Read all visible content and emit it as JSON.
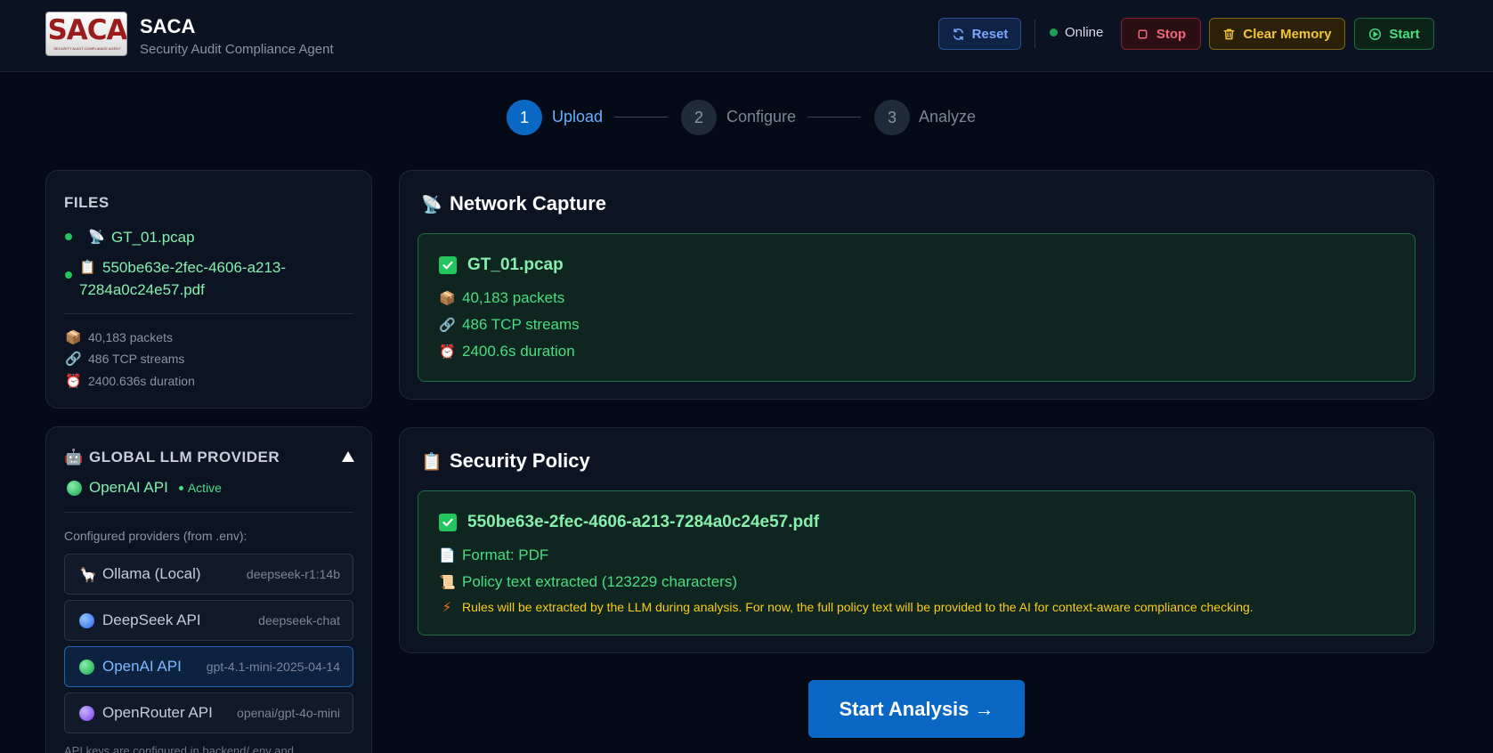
{
  "header": {
    "logo_text": "SACA",
    "logo_subtext": "SECURITY AUDIT COMPLIANCE AGENT",
    "title": "SACA",
    "subtitle": "Security Audit Compliance Agent",
    "buttons": {
      "reset": "Reset",
      "status": "Online",
      "stop": "Stop",
      "clear_memory": "Clear Memory",
      "start": "Start"
    }
  },
  "stepper": [
    {
      "number": "1",
      "label": "Upload",
      "state": "active"
    },
    {
      "number": "2",
      "label": "Configure",
      "state": "inactive"
    },
    {
      "number": "3",
      "label": "Analyze",
      "state": "inactive"
    }
  ],
  "files_panel": {
    "title": "FILES",
    "files": [
      {
        "icon": "📡",
        "name_line1": "GT_01.pcap",
        "name_line2": ""
      },
      {
        "icon": "📋",
        "name_line1": "550be63e-2fec-4606-a213-",
        "name_line2": "7284a0c24e57.pdf"
      }
    ],
    "stats": [
      {
        "icon": "📦",
        "text": "40,183 packets"
      },
      {
        "icon": "🔗",
        "text": "486 TCP streams"
      },
      {
        "icon": "⏰",
        "text": "2400.636s duration"
      }
    ]
  },
  "llm_panel": {
    "title": "GLOBAL LLM PROVIDER",
    "title_icon": "🤖",
    "current_provider": "OpenAI API",
    "current_status": "Active",
    "configured_label": "Configured providers (from .env):",
    "providers": [
      {
        "icon": "🦙",
        "name": "Ollama (Local)",
        "model": "deepseek-r1:14b",
        "active": false
      },
      {
        "name": "DeepSeek API",
        "model": "deepseek-chat",
        "active": false,
        "color": "#3b82f6"
      },
      {
        "name": "OpenAI API",
        "model": "gpt-4.1-mini-2025-04-14",
        "active": true,
        "color": "#22c55e"
      },
      {
        "name": "OpenRouter API",
        "model": "openai/gpt-4o-mini",
        "active": false,
        "color": "#8b5cf6"
      }
    ],
    "footer_note": "API keys are configured in backend/.env and"
  },
  "network_capture": {
    "title": "Network Capture",
    "title_icon": "📡",
    "file_name": "GT_01.pcap",
    "stats": [
      {
        "icon": "📦",
        "text": "40,183 packets"
      },
      {
        "icon": "🔗",
        "text": "486 TCP streams"
      },
      {
        "icon": "⏰",
        "text": "2400.6s duration"
      }
    ]
  },
  "security_policy": {
    "title": "Security Policy",
    "title_icon": "📋",
    "file_name": "550be63e-2fec-4606-a213-7284a0c24e57.pdf",
    "stats": [
      {
        "icon": "📄",
        "text": "Format: PDF"
      },
      {
        "icon": "📜",
        "text": "Policy text extracted (123229 characters)"
      }
    ],
    "note_icon": "⚡",
    "note": "Rules will be extracted by the LLM during analysis. For now, the full policy text will be provided to the AI for context-aware compliance checking."
  },
  "cta": {
    "label": "Start Analysis →"
  }
}
